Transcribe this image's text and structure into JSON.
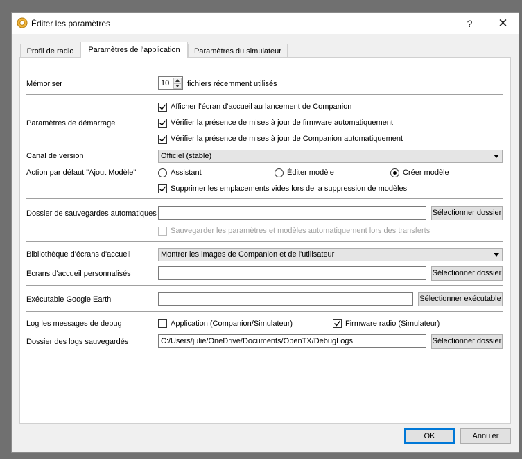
{
  "window": {
    "title": "Éditer les paramètres",
    "help_glyph": "?",
    "close_glyph": "✕",
    "icon": "gear-icon"
  },
  "tabs": [
    {
      "label": "Profil de radio",
      "active": false
    },
    {
      "label": "Paramètres de l'application",
      "active": true
    },
    {
      "label": "Paramètres du simulateur",
      "active": false
    }
  ],
  "settings": {
    "memorize": {
      "label": "Mémoriser",
      "value": "10",
      "suffix": "fichiers récemment utilisés"
    },
    "startup": {
      "label": "Paramètres de démarrage",
      "options": [
        {
          "label": "Afficher l'écran d'accueil au lancement de Companion",
          "checked": true
        },
        {
          "label": "Vérifier la présence de mises à jour de firmware automatiquement",
          "checked": true
        },
        {
          "label": "Vérifier la présence de mises à jour de Companion automatiquement",
          "checked": true
        }
      ]
    },
    "channel": {
      "label": "Canal de version",
      "value": "Officiel (stable)"
    },
    "default_action": {
      "label": "Action par défaut \"Ajout Modèle\"",
      "options": [
        {
          "label": "Assistant",
          "selected": false
        },
        {
          "label": "Éditer modèle",
          "selected": false
        },
        {
          "label": "Créer modèle",
          "selected": true
        }
      ]
    },
    "remove_empty": {
      "label": "Supprimer les emplacements vides lors de la suppression de modèles",
      "checked": true
    },
    "backup_folder": {
      "label": "Dossier de sauvegardes automatiques",
      "value": "",
      "button": "Sélectionner dossier",
      "auto_save": {
        "label": "Sauvegarder les paramètres et modèles automatiquement lors des transferts",
        "checked": false
      }
    },
    "splash_library": {
      "label": "Bibliothèque d'écrans d'accueil",
      "value": "Montrer les images de Companion et de l'utilisateur"
    },
    "custom_splash": {
      "label": "Ecrans d'accueil personnalisés",
      "value": "",
      "button": "Sélectionner dossier"
    },
    "google_earth": {
      "label": "Exécutable Google Earth",
      "value": "",
      "button": "Sélectionner exécutable"
    },
    "debug_log": {
      "label": "Log les messages de debug",
      "options": [
        {
          "label": "Application (Companion/Simulateur)",
          "checked": false
        },
        {
          "label": "Firmware radio (Simulateur)",
          "checked": true
        }
      ]
    },
    "log_folder": {
      "label": "Dossier des logs sauvegardés",
      "value": "C:/Users/julie/OneDrive/Documents/OpenTX/DebugLogs",
      "button": "Sélectionner dossier"
    }
  },
  "buttons": {
    "ok": "OK",
    "cancel": "Annuler"
  }
}
